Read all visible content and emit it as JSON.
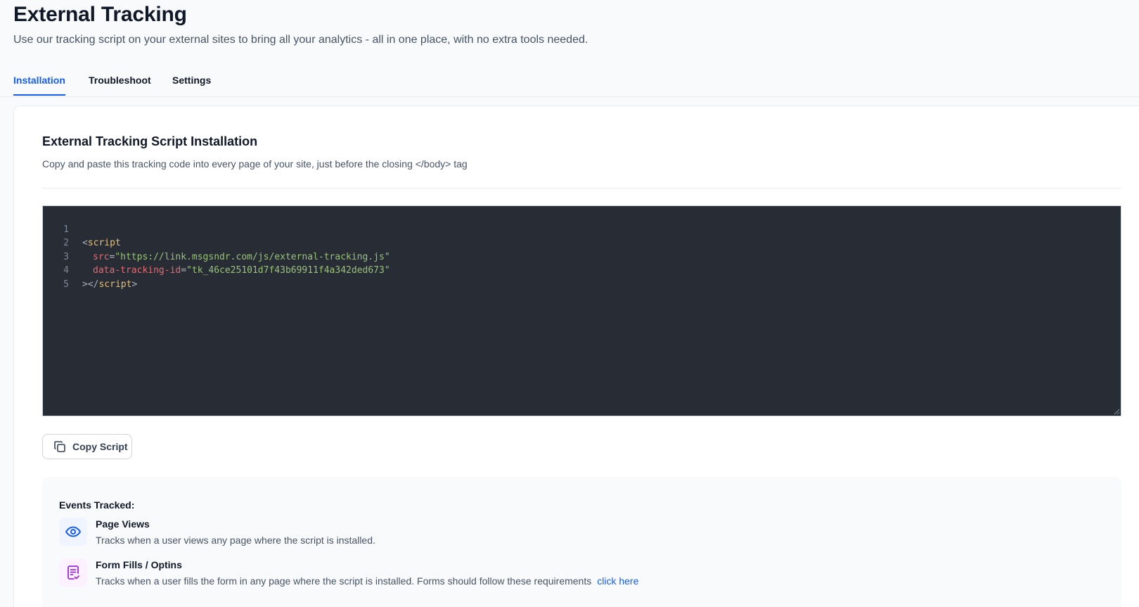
{
  "header": {
    "title": "External Tracking",
    "subtitle": "Use our tracking script on your external sites to bring all your analytics - all in one place, with no extra tools needed."
  },
  "tabs": [
    {
      "label": "Installation",
      "active": true
    },
    {
      "label": "Troubleshoot",
      "active": false
    },
    {
      "label": "Settings",
      "active": false
    }
  ],
  "installation": {
    "title": "External Tracking Script Installation",
    "description": "Copy and paste this tracking code into every page of your site, just before the closing </body> tag",
    "code_lines": [
      {
        "number": "1"
      },
      {
        "number": "2"
      },
      {
        "number": "3"
      },
      {
        "number": "4"
      },
      {
        "number": "5"
      }
    ],
    "code_tokens": {
      "open_bracket": "<",
      "tag_name": "script",
      "src_attr": "src",
      "equals": "=",
      "src_value": "\"https://link.msgsndr.com/js/external-tracking.js\"",
      "tracking_attr": "data-tracking-id",
      "tracking_value": "\"tk_46ce25101d7f43b69911f4a342ded673\"",
      "close_start": "></",
      "close_tag_name": "script",
      "close_end": ">"
    },
    "copy_button_label": "Copy Script"
  },
  "events": {
    "title": "Events Tracked:",
    "items": [
      {
        "name": "Page Views",
        "description": "Tracks when a user views any page where the script is installed.",
        "icon": "eye-icon",
        "icon_color": "#155eef",
        "icon_bg": "#eff4ff"
      },
      {
        "name": "Form Fills / Optins",
        "description": "Tracks when a user fills the form in any page where the script is installed. Forms should follow these requirements",
        "link_label": "click here",
        "icon": "form-check-icon",
        "icon_color": "#9e2bd6",
        "icon_bg": "#fbf1ff"
      }
    ]
  },
  "colors": {
    "accent": "#155eef",
    "editor_bg": "#282c34"
  }
}
